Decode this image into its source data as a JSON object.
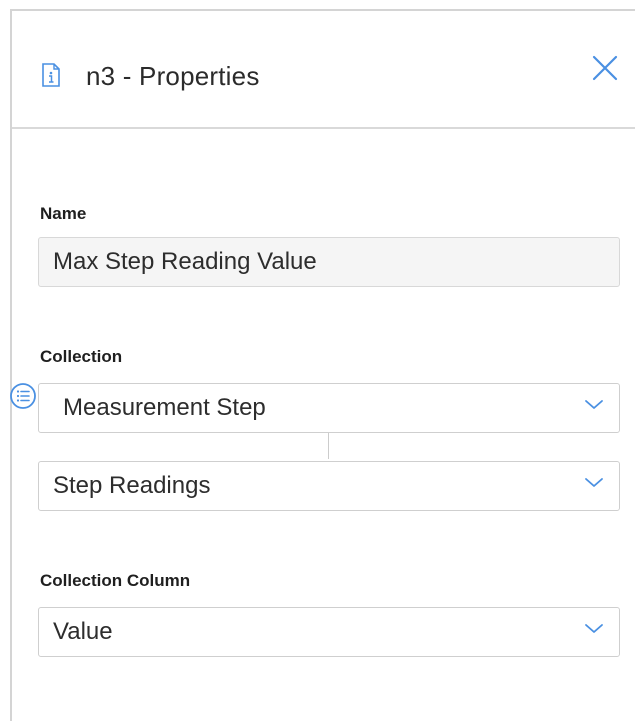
{
  "header": {
    "title": "n3 - Properties",
    "icon": "info-document-icon",
    "close_icon": "close-icon"
  },
  "name_section": {
    "label": "Name",
    "value": "Max Step Reading Value"
  },
  "collection_section": {
    "label": "Collection",
    "primary_value": "Measurement Step",
    "secondary_value": "Step Readings",
    "list_icon": "list-icon",
    "dropdown_icon": "chevron-down-icon"
  },
  "collection_column_section": {
    "label": "Collection Column",
    "value": "Value",
    "dropdown_icon": "chevron-down-icon"
  },
  "colors": {
    "accent": "#4a90e2",
    "border": "#cfcfcf",
    "text": "#2d2d2d"
  }
}
